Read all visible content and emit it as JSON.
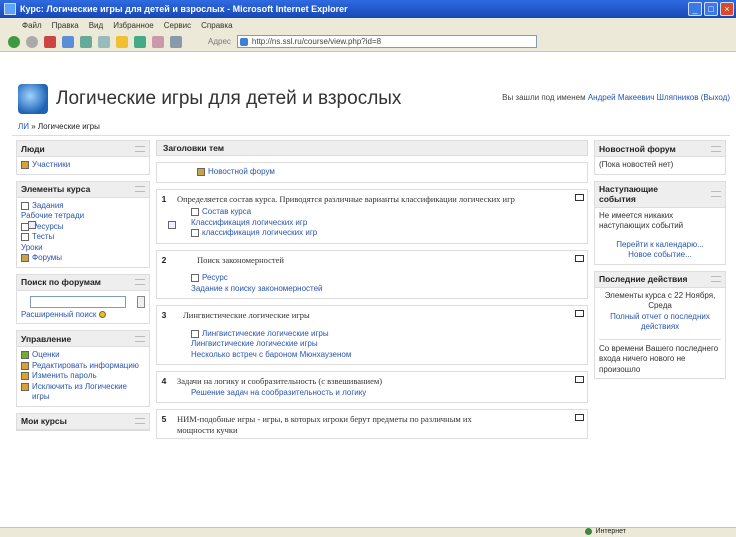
{
  "window": {
    "title": "Курс: Логические игры для детей и взрослых - Microsoft Internet Explorer"
  },
  "menu": [
    "Файл",
    "Правка",
    "Вид",
    "Избранное",
    "Сервис",
    "Справка"
  ],
  "toolbar": {
    "address_label": "Адрес",
    "address_url": "http://ns.ssl.ru/course/view.php?id=8"
  },
  "site": {
    "title": "Логические игры для детей и взрослых",
    "login_prefix": "Вы зашли под именем",
    "user_name": "Андрей Макеевич Шляпников",
    "logout": "(Выход)"
  },
  "breadcrumb": {
    "root": "ЛИ",
    "sep": "»",
    "current": "Логические игры"
  },
  "left": {
    "people": {
      "title": "Люди",
      "items": [
        "Участники"
      ]
    },
    "activities": {
      "title": "Элементы курса",
      "items": [
        "Задания",
        "Рабочие тетради",
        "Ресурсы",
        "Тесты",
        "Уроки",
        "Форумы"
      ]
    },
    "forum_search": {
      "title": "Поиск по форумам",
      "advanced": "Расширенный поиск"
    },
    "admin": {
      "title": "Управление",
      "items": [
        "Оценки",
        "Редактировать информацию",
        "Изменить пароль",
        "Исключить из Логические игры"
      ]
    },
    "my_courses": {
      "title": "Мои курсы"
    }
  },
  "center": {
    "header": "Заголовки тем",
    "news_forum": "Новостной форум",
    "topics": [
      {
        "num": "1",
        "summary": "Определяется состав курса. Приводятся различные варианты классификации логических игр",
        "links": [
          "Состав курса",
          "Классификация логических игр",
          "классификация логических игр"
        ]
      },
      {
        "num": "2",
        "summary": "Поиск закономерностей",
        "links": [
          "Ресурс",
          "Задание к поиску закономерностей"
        ]
      },
      {
        "num": "3",
        "summary": "Лингвистические логические игры",
        "links": [
          "Лингвистические логические игры",
          "Лингвистические логические игры",
          "Несколько встреч с бароном Мюнхаузеном"
        ]
      },
      {
        "num": "4",
        "summary": "Задачи на логику и сообразительность (с взвешиванием)",
        "links": [
          "Решение задач на сообразительность и логику"
        ]
      },
      {
        "num": "5",
        "summary": "НИМ-подобные игры - игры, в которых игроки берут предметы по различным их",
        "summary2": "мощности кучки",
        "links": []
      }
    ]
  },
  "right": {
    "news": {
      "title": "Новостной форум",
      "body": "(Пока новостей нет)"
    },
    "events": {
      "title": "Наступающие события",
      "body": "Не имеется никаких наступающих событий",
      "calendar": "Перейти к календарю...",
      "new_event": "Новое событие..."
    },
    "recent": {
      "title": "Последние действия",
      "since": "Элементы курса с 22 Ноября, Среда",
      "full_report": "Полный отчет о последних действиях",
      "nothing": "Со времени Вашего последнего входа ничего нового не произошло"
    }
  },
  "status": {
    "zone": "Интернет"
  }
}
